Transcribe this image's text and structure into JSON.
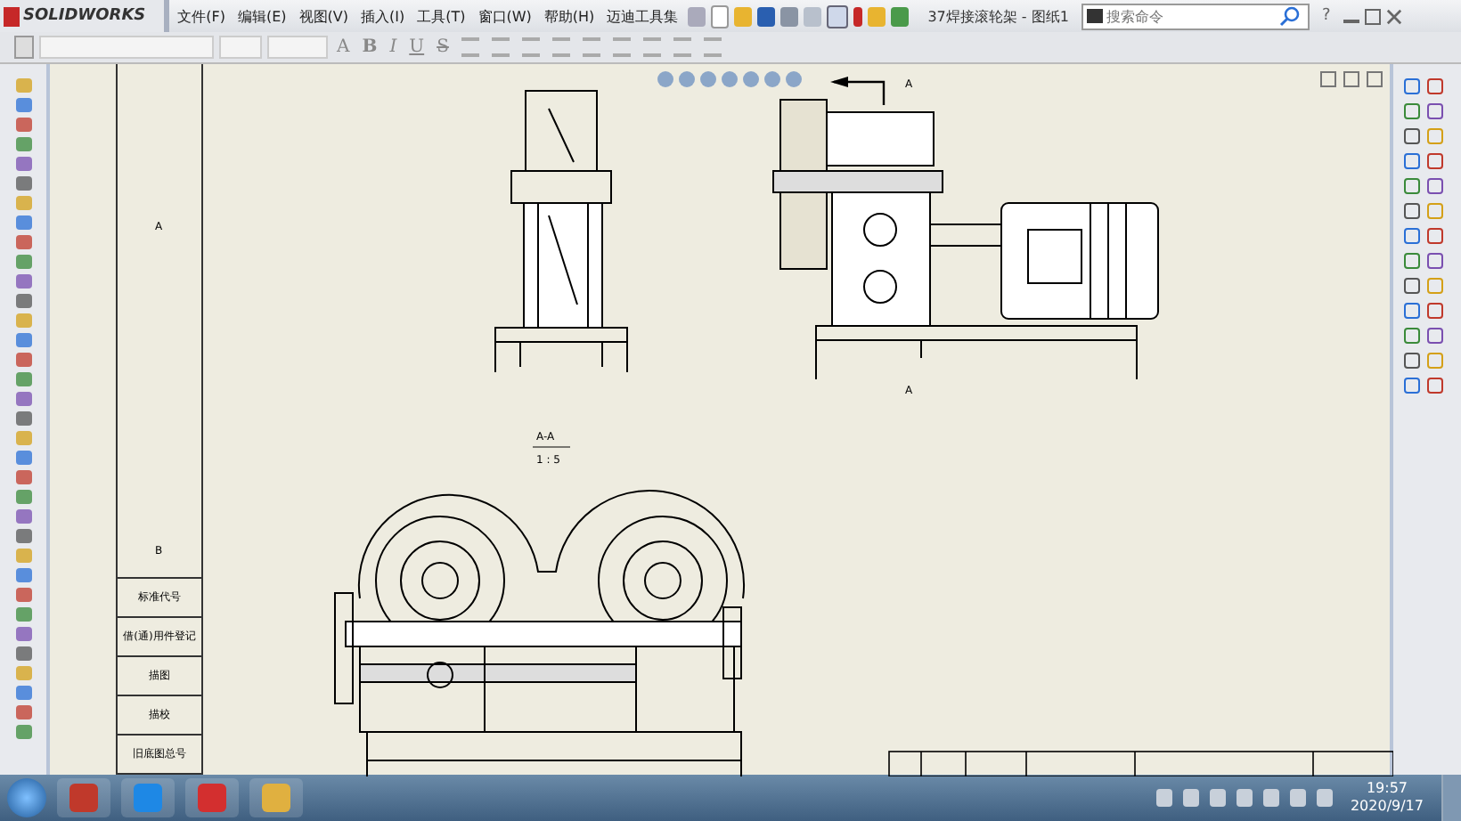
{
  "app": {
    "logo": "SOLIDWORKS",
    "menu": [
      "文件(F)",
      "编辑(E)",
      "视图(V)",
      "插入(I)",
      "工具(T)",
      "窗口(W)",
      "帮助(H)",
      "迈迪工具集"
    ],
    "document_title": "37焊接滚轮架 - 图纸1",
    "search": {
      "placeholder": "搜索命令"
    },
    "help_mark": "?",
    "format_buttons": [
      "A",
      "B",
      "I",
      "U",
      "S"
    ]
  },
  "sheet": {
    "zone_labels": [
      "A",
      "B"
    ],
    "section_label": "A-A",
    "scale": "1 : 5",
    "cut_labels": [
      "A",
      "A"
    ],
    "title_block": [
      "标准代号",
      "借(通)用件登记",
      "描图",
      "描校",
      "旧底图总号"
    ]
  },
  "taskbar": {
    "time": "19:57",
    "date": "2020/9/17"
  }
}
